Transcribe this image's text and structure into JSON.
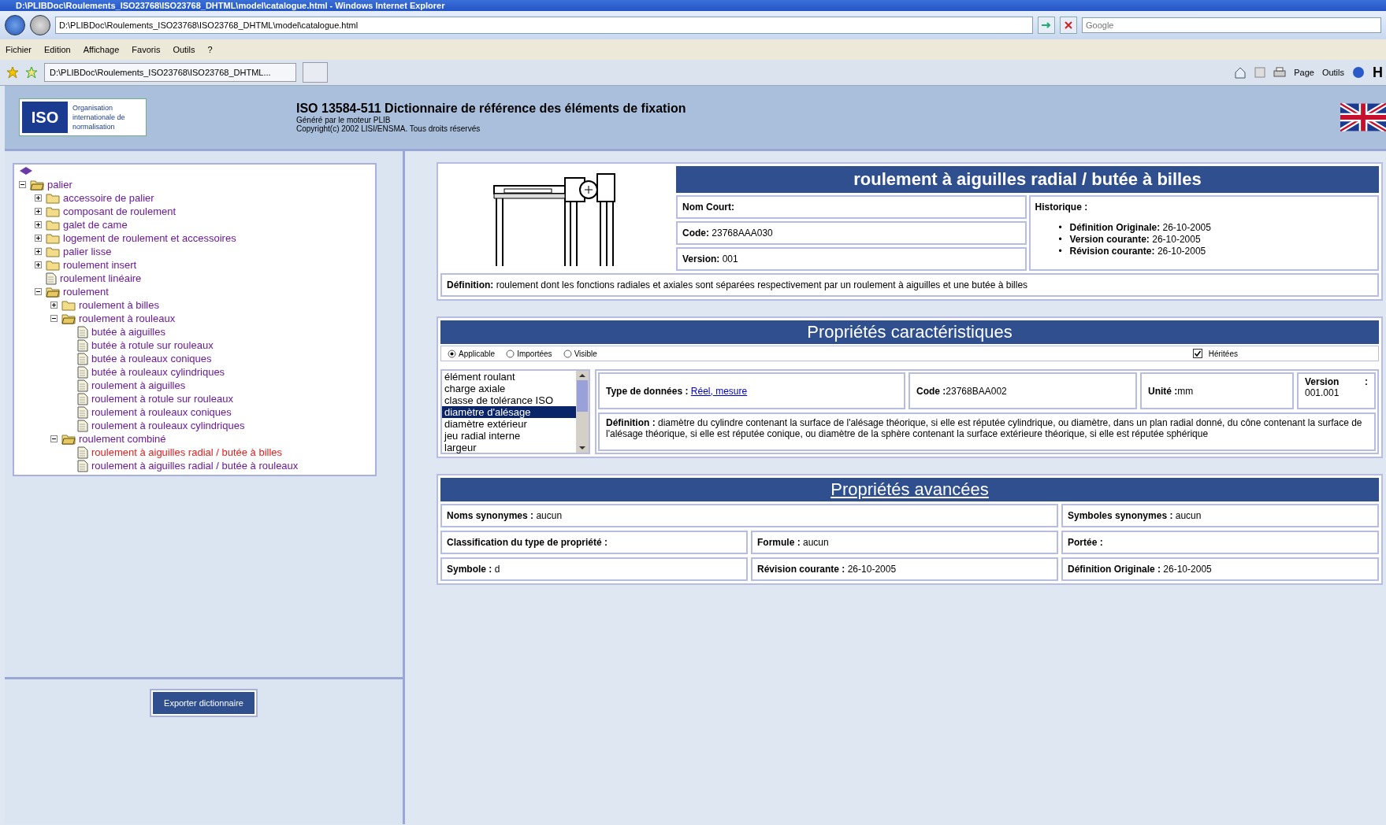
{
  "window": {
    "title": "D:\\PLIBDoc\\Roulements_ISO23768\\ISO23768_DHTML\\model\\catalogue.html - Windows Internet Explorer"
  },
  "address_bar": {
    "value": "D:\\PLIBDoc\\Roulements_ISO23768\\ISO23768_DHTML\\model\\catalogue.html"
  },
  "search": {
    "placeholder": "Google"
  },
  "menu": [
    "Fichier",
    "Edition",
    "Affichage",
    "Favoris",
    "Outils",
    "?"
  ],
  "tab": {
    "label": "D:\\PLIBDoc\\Roulements_ISO23768\\ISO23768_DHTML..."
  },
  "toolbar": {
    "page": "Page",
    "tools": "Outils",
    "cut_letter": "H"
  },
  "header": {
    "logo": "ISO",
    "org_lines": [
      "Organisation",
      "internationale de",
      "normalisation"
    ],
    "title": "ISO 13584-511 Dictionnaire de référence des éléments de fixation",
    "subtitle": "Généré par le moteur PLIB",
    "copyright": "Copyright(c) 2002 LISI/ENSMA. Tous droits réservés"
  },
  "tree": [
    {
      "label": "palier",
      "kind": "folder",
      "expanded": true,
      "selected": false,
      "children": [
        {
          "label": "accessoire de palier",
          "kind": "folder",
          "expanded": false,
          "selected": false
        },
        {
          "label": "composant de roulement",
          "kind": "folder",
          "expanded": false,
          "selected": false
        },
        {
          "label": "galet de came",
          "kind": "folder",
          "expanded": false,
          "selected": false
        },
        {
          "label": "logement de roulement et accessoires",
          "kind": "folder",
          "expanded": false,
          "selected": false
        },
        {
          "label": "palier lisse",
          "kind": "folder",
          "expanded": false,
          "selected": false
        },
        {
          "label": "roulement insert",
          "kind": "folder",
          "expanded": false,
          "selected": false
        },
        {
          "label": "roulement linéaire",
          "kind": "doc",
          "selected": false
        },
        {
          "label": "roulement",
          "kind": "folder",
          "expanded": true,
          "selected": false,
          "children": [
            {
              "label": "roulement à billes",
              "kind": "folder",
              "expanded": false,
              "selected": false
            },
            {
              "label": "roulement à rouleaux",
              "kind": "folder",
              "expanded": true,
              "selected": false,
              "children": [
                {
                  "label": "butée à aiguilles",
                  "kind": "doc",
                  "selected": false
                },
                {
                  "label": "butée à rotule sur rouleaux",
                  "kind": "doc",
                  "selected": false
                },
                {
                  "label": "butée à rouleaux coniques",
                  "kind": "doc",
                  "selected": false
                },
                {
                  "label": "butée à rouleaux cylindriques",
                  "kind": "doc",
                  "selected": false
                },
                {
                  "label": "roulement à aiguilles",
                  "kind": "doc",
                  "selected": false
                },
                {
                  "label": "roulement à rotule sur rouleaux",
                  "kind": "doc",
                  "selected": false
                },
                {
                  "label": "roulement à rouleaux coniques",
                  "kind": "doc",
                  "selected": false
                },
                {
                  "label": "roulement à rouleaux cylindriques",
                  "kind": "doc",
                  "selected": false
                }
              ]
            },
            {
              "label": "roulement combiné",
              "kind": "folder",
              "expanded": true,
              "selected": false,
              "children": [
                {
                  "label": "roulement à aiguilles radial / butée à billes",
                  "kind": "doc",
                  "selected": true
                },
                {
                  "label": "roulement à aiguilles radial / butée à rouleaux",
                  "kind": "doc",
                  "selected": false
                }
              ]
            }
          ]
        }
      ]
    }
  ],
  "export_button": "Exporter dictionnaire",
  "item": {
    "title": "roulement à aiguilles radial / butée à billes",
    "fields": [
      {
        "label": "Nom Court:"
      },
      {
        "label": "Code:",
        "value": "23768AAA030"
      },
      {
        "label": "Version:",
        "value": "001"
      }
    ],
    "history_label": "Historique :",
    "history": [
      {
        "marker": "•",
        "label": "Définition Originale:",
        "value": "26-10-2005"
      },
      {
        "marker": "•",
        "label": "Version courante:",
        "value": "26-10-2005"
      },
      {
        "marker": "•",
        "label": "Révision courante:",
        "value": "26-10-2005"
      }
    ],
    "definition": {
      "label": "Définition:",
      "value": "roulement dont les fonctions radiales et axiales sont séparées respectivement par un roulement à aiguilles et une butée à billes"
    }
  },
  "properties": {
    "title": "Propriétés caractéristiques",
    "filters": [
      {
        "label": "Applicable",
        "selected": true
      },
      {
        "label": "Importées",
        "selected": false
      },
      {
        "label": "Visible",
        "selected": false
      }
    ],
    "inherited": {
      "label": "Héritées",
      "checked": true
    },
    "list": [
      {
        "label": "élément roulant",
        "selected": false
      },
      {
        "label": "charge axiale",
        "selected": false
      },
      {
        "label": "classe de tolérance ISO",
        "selected": false
      },
      {
        "label": "diamètre d'alésage",
        "selected": true
      },
      {
        "label": "diamètre extérieur",
        "selected": false
      },
      {
        "label": "jeu radial interne",
        "selected": false
      },
      {
        "label": "largeur",
        "selected": false
      }
    ],
    "data_type": {
      "label": "Type de données :",
      "value": "Réel, mesure"
    },
    "code": {
      "label": "Code :",
      "value": "23768BAA002"
    },
    "unit": {
      "label": "Unité :",
      "value": "mm"
    },
    "version": {
      "label": "Version",
      "colon": ":",
      "value": "001.001"
    },
    "definition": {
      "label": "Définition :",
      "value": "diamètre du cylindre contenant la surface de l'alésage théorique, si elle est réputée cylindrique, ou diamètre, dans un plan radial donné, du cône contenant la surface de l'alésage théorique, si elle est réputée conique, ou diamètre de la sphère contenant la surface extérieure théorique, si elle est réputée sphérique"
    }
  },
  "advanced": {
    "title": "Propriétés avancées",
    "synonyms": {
      "label": "Noms synonymes :",
      "value": "aucun"
    },
    "symbol_synonyms": {
      "label": "Symboles synonymes :",
      "value": "aucun"
    },
    "classification": {
      "label": "Classification du type de propriété :"
    },
    "formula": {
      "label": "Formule :",
      "value": "aucun"
    },
    "scope": {
      "label": "Portée :"
    },
    "symbol": {
      "label": "Symbole :",
      "value": "d"
    },
    "current_revision": {
      "label": "Révision courante :",
      "value": "26-10-2005"
    },
    "original_definition": {
      "label": "Définition Originale :",
      "value": "26-10-2005"
    }
  }
}
